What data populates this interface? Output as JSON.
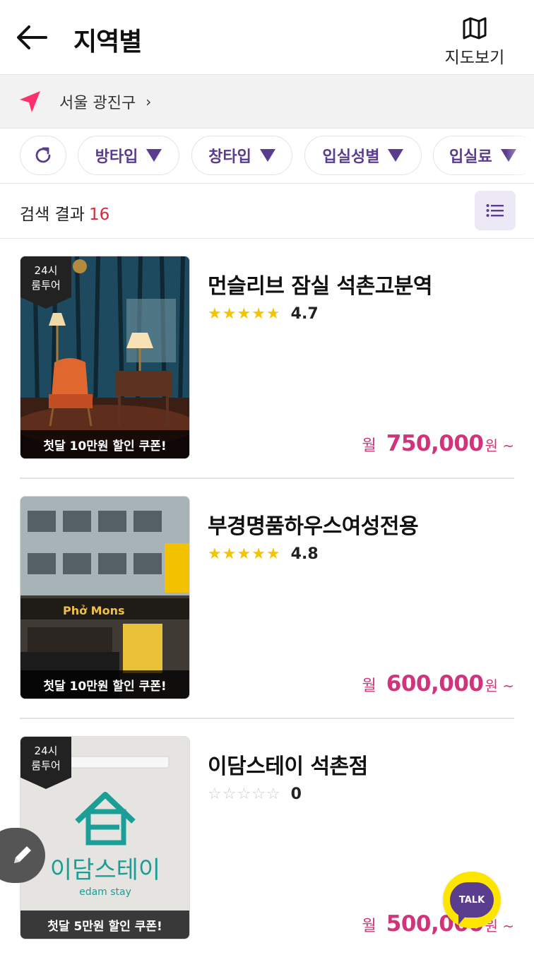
{
  "header": {
    "title": "지역별",
    "map_label": "지도보기"
  },
  "location": {
    "text": "서울 광진구",
    "chevron": "›"
  },
  "filters": [
    {
      "label": "방타입"
    },
    {
      "label": "창타입"
    },
    {
      "label": "입실성별"
    },
    {
      "label": "입실료"
    }
  ],
  "results": {
    "label": "검색 결과",
    "count": "16"
  },
  "listings": [
    {
      "name": "먼슬리브 잠실 석촌고분역",
      "rating": "4.7",
      "rating_value": 4.7,
      "tag": [
        "24시",
        "룸투어"
      ],
      "coupon": "첫달 10만원 할인 쿠폰!",
      "price_prefix": "월",
      "price": "750,000",
      "price_suffix": "원 ~"
    },
    {
      "name": "부경명품하우스여성전용",
      "rating": "4.8",
      "rating_value": 4.8,
      "tag": [],
      "coupon": "첫달 10만원 할인 쿠폰!",
      "price_prefix": "월",
      "price": "600,000",
      "price_suffix": "원 ~"
    },
    {
      "name": "이담스테이 석촌점",
      "rating": "0",
      "rating_value": 0,
      "tag": [
        "24시",
        "룸투어"
      ],
      "coupon": "첫달 5만원 할인 쿠폰!",
      "price_prefix": "월",
      "price": "500,000",
      "price_suffix": "원 ~"
    }
  ],
  "photo_text": {
    "building_sign": "Phở Mons",
    "logo_kr": "이담스테이",
    "logo_en": "edam stay"
  },
  "talk_button": {
    "label": "TALK"
  },
  "icons": {
    "back": "back-arrow-icon",
    "map": "map-icon",
    "location": "navigation-arrow-icon",
    "refresh": "refresh-icon",
    "list": "list-icon",
    "edit": "pencil-icon"
  },
  "colors": {
    "accent_purple": "#5a3d8f",
    "price_pink": "#d1347a",
    "count_red": "#d42a3e",
    "star_gold": "#f5c400",
    "location_pink": "#ff2e6e",
    "talk_yellow": "#fde500"
  }
}
